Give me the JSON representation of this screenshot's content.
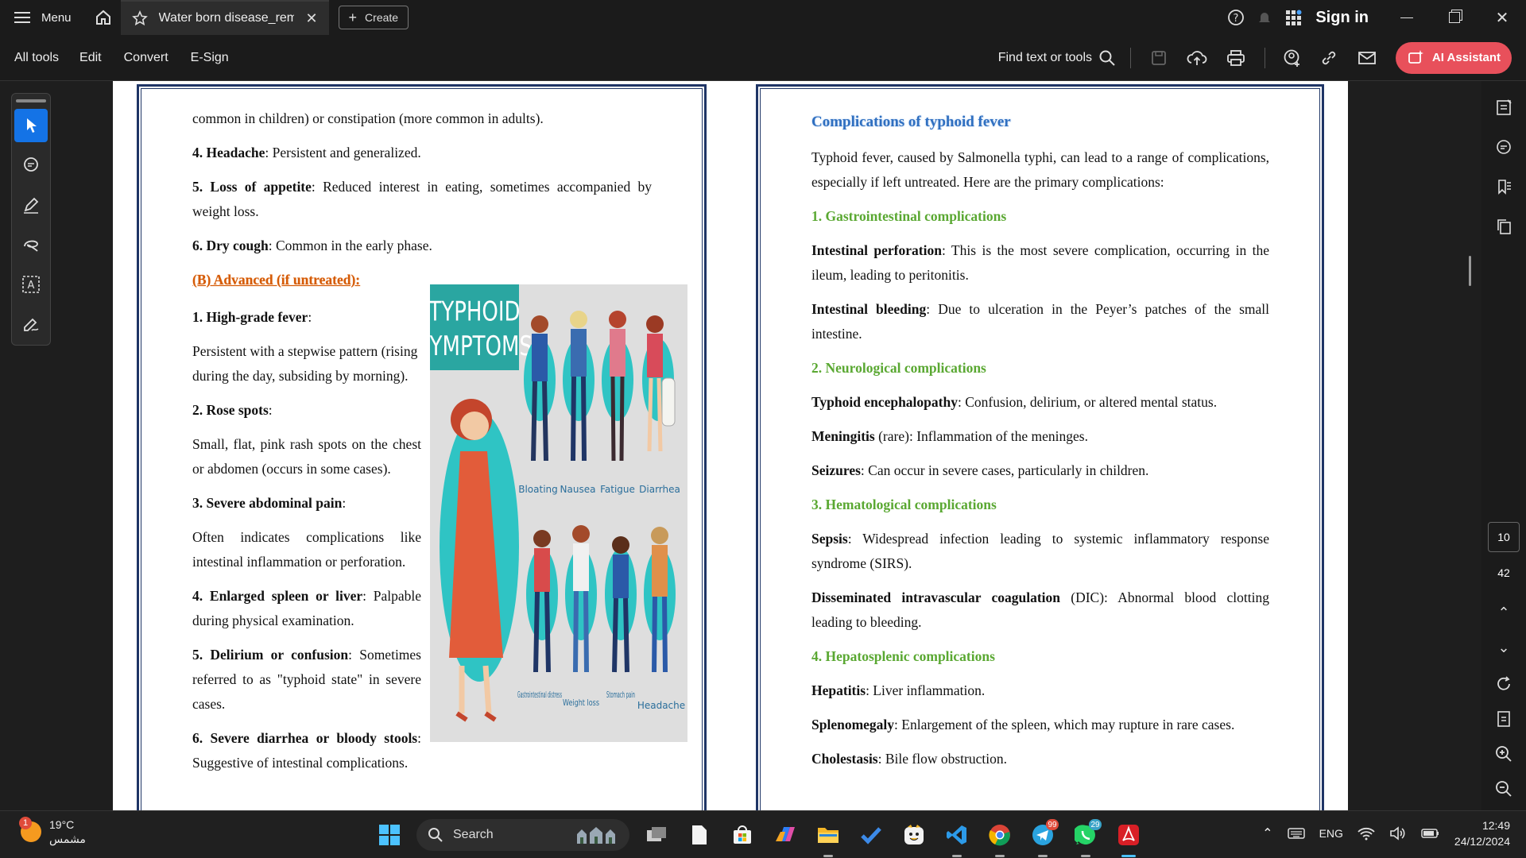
{
  "titlebar": {
    "menu_label": "Menu",
    "tab_title": "Water born disease_rem...",
    "create_label": "Create",
    "signin_label": "Sign in"
  },
  "toolbar": {
    "items": [
      "All tools",
      "Edit",
      "Convert",
      "E-Sign"
    ],
    "find_label": "Find text or tools",
    "ai_label": "AI Assistant",
    "ai_color": "#e8505b"
  },
  "left_page": {
    "p1": "common in children) or constipation (more common in adults).",
    "p2_b": "4. Headache",
    "p2": ": Persistent and generalized.",
    "p3_b": "5. Loss of appetite",
    "p3": ": Reduced interest in eating, sometimes accompanied by weight loss.",
    "p4_b": "6. Dry cough",
    "p4": ": Common in the early phase.",
    "heading_b": "(B) Advanced (if untreated):",
    "i1_b": "1. High-grade fever",
    "i1": ":",
    "i1d": "Persistent with a stepwise pattern (rising during the day, subsiding by morning).",
    "i2_b": "2. Rose spots",
    "i2": ":",
    "i2d": "Small, flat, pink rash spots on the chest or abdomen (occurs in some cases).",
    "i3_b": "3. Severe abdominal pain",
    "i3": ":",
    "i3d": "Often indicates complications like intestinal inflammation or perforation.",
    "i4_b": "4. Enlarged spleen or liver",
    "i4": ": Palpable during physical examination.",
    "i5_b": "5. Delirium or confusion",
    "i5": ": Sometimes referred to as \"typhoid state\" in severe cases.",
    "i6_b": "6. Severe diarrhea or bloody stools",
    "i6": ": Suggestive of intestinal complications."
  },
  "illustration": {
    "title_1": "TYPHOID",
    "title_2": "SYMPTOMS",
    "labels": [
      "Bloating",
      "Nausea",
      "Fatigue",
      "Diarrhea",
      "Gastrointestinal distress",
      "Weight loss",
      "Stomach pain",
      "Headache"
    ],
    "teal": "#2fc4c4"
  },
  "right_page": {
    "title": "Complications of typhoid fever",
    "intro": "Typhoid fever, caused by Salmonella typhi, can lead to a range of complications, especially if left untreated. Here are the primary complications:",
    "s1": "1. Gastrointestinal complications",
    "s1a_b": "Intestinal perforation",
    "s1a": ": This is the most severe complication, occurring in the ileum, leading to peritonitis.",
    "s1b_b": "Intestinal bleeding",
    "s1b": ": Due to ulceration in the Peyer’s patches of the small intestine.",
    "s2": "2. Neurological complications",
    "s2a_b": "Typhoid encephalopathy",
    "s2a": ": Confusion, delirium, or altered mental status.",
    "s2b_b": "Meningitis",
    "s2b": " (rare): Inflammation of the meninges.",
    "s2c_b": "Seizures",
    "s2c": ": Can occur in severe cases, particularly in children.",
    "s3": "3. Hematological complications",
    "s3a_b": "Sepsis",
    "s3a": ": Widespread infection leading to systemic inflammatory response syndrome (SIRS).",
    "s3b_b": "Disseminated intravascular coagulation",
    "s3b": " (DIC): Abnormal blood clotting leading to bleeding.",
    "s4": "4. Hepatosplenic complications",
    "s4a_b": "Hepatitis",
    "s4a": ": Liver inflammation.",
    "s4b_b": "Splenomegaly",
    "s4b": ": Enlargement of the spleen, which may rupture in rare cases.",
    "s4c_b": "Cholestasis",
    "s4c": ": Bile flow obstruction."
  },
  "pager": {
    "current": "10",
    "total": "42"
  },
  "taskbar": {
    "temp": "19°C",
    "weather_desc": "مشمس",
    "weather_badge": "1",
    "search_label": "Search",
    "telegram_badge": "99",
    "whatsapp_badge": "29",
    "lang": "ENG",
    "time": "12:49",
    "date": "24/12/2024"
  }
}
